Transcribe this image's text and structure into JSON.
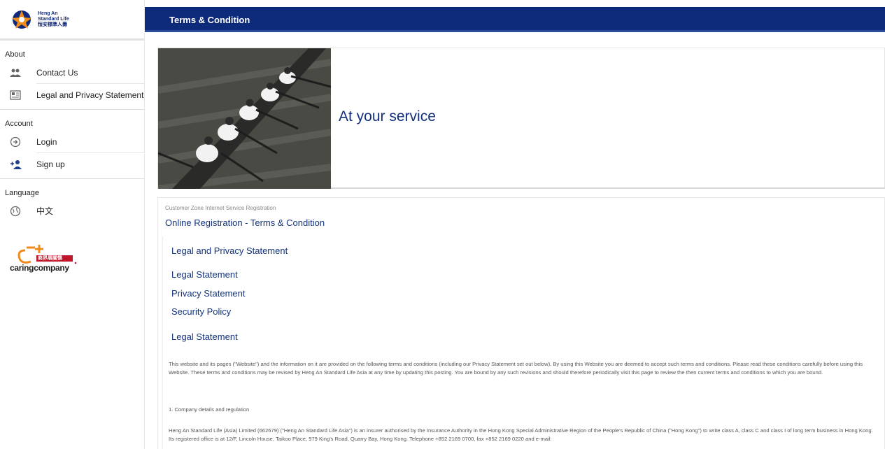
{
  "brand": {
    "name_line1": "Heng An",
    "name_line2": "Standard Life",
    "name_line3": "恒安標準人壽"
  },
  "sidebar": {
    "sections": [
      {
        "label": "About",
        "items": [
          {
            "label": "Contact Us",
            "icon": "people-icon"
          },
          {
            "label": "Legal and Privacy Statement",
            "icon": "newspaper-icon"
          }
        ]
      },
      {
        "label": "Account",
        "items": [
          {
            "label": "Login",
            "icon": "login-icon"
          },
          {
            "label": "Sign up",
            "icon": "add-user-icon"
          }
        ]
      },
      {
        "label": "Language",
        "items": [
          {
            "label": "中文",
            "icon": "globe-icon"
          }
        ]
      }
    ],
    "badge": {
      "text": "caringcompany",
      "sub": "商界展關懷"
    }
  },
  "header": {
    "title": "Terms & Condition"
  },
  "hero": {
    "title": "At your service"
  },
  "content": {
    "breadcrumb": "Customer Zone Internet Service Registration",
    "title": "Online Registration - Terms & Condition",
    "lp_heading": "Legal and Privacy Statement",
    "links": [
      "Legal Statement",
      "Privacy Statement",
      "Security Policy"
    ],
    "legal_heading": "Legal Statement",
    "para1": "This website and its pages (\"Website\") and the information on it are provided on the following terms and conditions (including our Privacy Statement set out below). By using this Website you are deemed to accept such terms and conditions. Please read these conditions carefully before using this Website. These terms and conditions may be revised by Heng An Standard Life Asia at any time by updating this posting. You are bound by any such revisions and should therefore periodically visit this page to review the then current terms and conditions to which you are bound.",
    "para2": "1. Company details and regulation",
    "para3": "Heng An Standard Life (Asia) Limited (662679) (\"Heng An Standard Life Asia\") is an insurer authorised by the Insurance Authority in the Hong Kong Special Administrative Region of the People's Republic of China (\"Hong Kong\") to write class A, class C and class I of long term business in Hong Kong. Its registered office is at 12/F, Lincoln House, Taikoo Place, 979 King's Road, Quarry Bay, Hong Kong. Telephone +852 2169 0700, fax +852 2169 0220 and e-mail:"
  },
  "colors": {
    "navy": "#0e2a7a",
    "link": "#14347f",
    "orange": "#f08a1c"
  }
}
